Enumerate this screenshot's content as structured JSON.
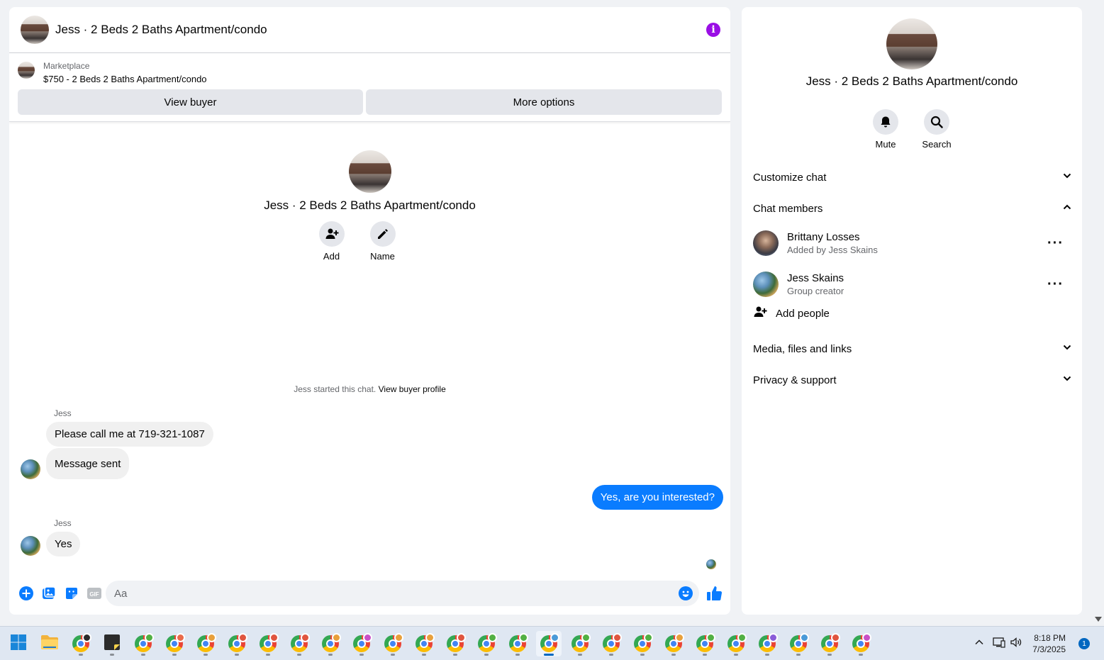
{
  "chat": {
    "title": "Jess · 2 Beds 2 Baths Apartment/condo",
    "listing": {
      "label": "Marketplace",
      "price_title": "$750 - 2 Beds 2 Baths Apartment/condo",
      "view_buyer": "View buyer",
      "more_options": "More options"
    },
    "intro": {
      "title": "Jess · 2 Beds 2 Baths Apartment/condo",
      "add_label": "Add",
      "name_label": "Name"
    },
    "started_text": "Jess started this chat.",
    "started_link": "View buyer profile",
    "messages": [
      {
        "sender": "Jess",
        "text": "Please call me at 719-321-1087"
      },
      {
        "text": "Message sent"
      },
      {
        "text": "Yes, are you interested?",
        "mine": true
      },
      {
        "sender": "Jess",
        "text": "Yes"
      }
    ],
    "composer": {
      "placeholder": "Aa"
    }
  },
  "details": {
    "title": "Jess · 2 Beds 2 Baths Apartment/condo",
    "mute_label": "Mute",
    "search_label": "Search",
    "sections": {
      "customize": "Customize chat",
      "members": "Chat members",
      "media": "Media, files and links",
      "privacy": "Privacy & support"
    },
    "members": [
      {
        "name": "Brittany Losses",
        "sub": "Added by Jess Skains"
      },
      {
        "name": "Jess Skains",
        "sub": "Group creator"
      }
    ],
    "add_people": "Add people"
  },
  "taskbar": {
    "time": "8:18 PM",
    "date": "7/3/2025",
    "notifications": "1",
    "profile_badge_colors": [
      "#52b043",
      "#ea6a4a",
      "#e8a03c",
      "#e0553f",
      "#e0553f",
      "#e0553f",
      "#e8a03c",
      "#c94fc7",
      "#e8a03c",
      "#e8a03c",
      "#e0553f",
      "#52b043",
      "#52b043",
      "#4a9ad8",
      "#52b043",
      "#e0553f",
      "#52b043",
      "#e8a03c",
      "#52b043",
      "#52b043",
      "#8a5cd8",
      "#4a9ad8",
      "#e0553f",
      "#c94fc7"
    ]
  },
  "colors": {
    "accent": "#0a7cff",
    "info": "#9a0ee5"
  }
}
